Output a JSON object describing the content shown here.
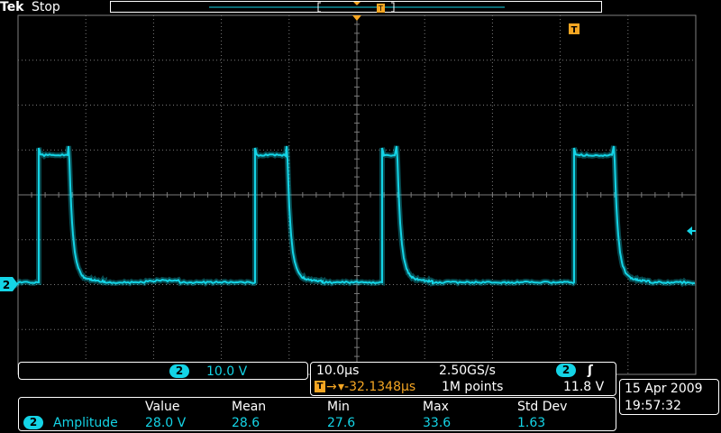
{
  "brand": {
    "tek": "Tek",
    "state": "Stop"
  },
  "trigger_marker": {
    "label": "T"
  },
  "channel": {
    "number": "2",
    "scale": "10.0 V"
  },
  "timebase": {
    "horizontal_scale": "10.0µs",
    "sample_rate": "2.50GS/s",
    "trigger_position": "▾-32.1348µs",
    "record_length": "1M points",
    "trigger_channel": "2",
    "trigger_slope_symbol": "ʃ",
    "trigger_level": "11.8 V"
  },
  "measurements": {
    "headers": [
      "Value",
      "Mean",
      "Min",
      "Max",
      "Std Dev"
    ],
    "rows": [
      {
        "channel": "2",
        "name": "Amplitude",
        "values": [
          "28.0 V",
          "28.6",
          "27.6",
          "33.6",
          "1.63"
        ]
      }
    ]
  },
  "datetime": {
    "date": "15 Apr 2009",
    "time": "19:57:32"
  },
  "colors": {
    "trace": "#14d4e6",
    "trigger": "#f5a623",
    "grid": "#7a7a7a",
    "background": "#000000"
  }
}
